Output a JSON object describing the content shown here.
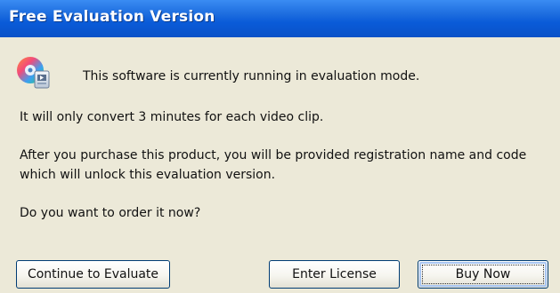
{
  "window": {
    "title": "Free Evaluation Version"
  },
  "body": {
    "heading": "This software is currently running in evaluation mode.",
    "limit": "It will only convert 3 minutes for each video clip.",
    "after_line1": "After you purchase this product, you will be provided registration name and code",
    "after_line2": "which will unlock this evaluation version.",
    "question": "Do you want to order it now?"
  },
  "buttons": {
    "continue_label": "Continue to Evaluate",
    "license_label": "Enter License",
    "buy_label": "Buy Now"
  },
  "icons": {
    "app": "video-converter-app-icon"
  },
  "colors": {
    "title_bar": "#0a5bd8",
    "dialog_background": "#ece9d8",
    "button_border": "#003c74"
  }
}
